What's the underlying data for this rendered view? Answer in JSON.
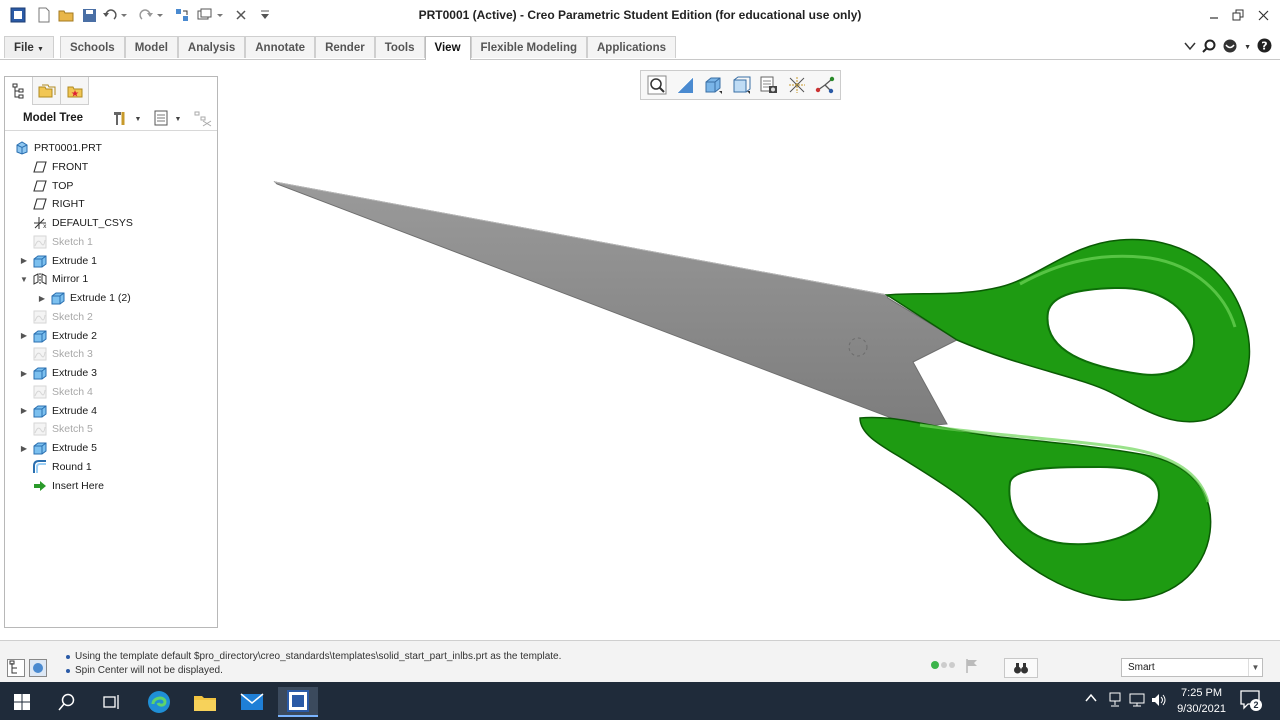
{
  "window": {
    "title": "PRT0001 (Active) - Creo Parametric Student Edition (for educational use only)"
  },
  "ribbon": {
    "file_label": "File",
    "tabs": [
      {
        "label": "Schools"
      },
      {
        "label": "Model"
      },
      {
        "label": "Analysis"
      },
      {
        "label": "Annotate"
      },
      {
        "label": "Render"
      },
      {
        "label": "Tools"
      },
      {
        "label": "View"
      },
      {
        "label": "Flexible Modeling"
      },
      {
        "label": "Applications"
      }
    ],
    "active_tab": "View"
  },
  "model_tree": {
    "title": "Model Tree",
    "items": [
      {
        "label": "PRT0001.PRT",
        "icon": "part-icon",
        "dim": false,
        "expand": ""
      },
      {
        "label": "FRONT",
        "icon": "datum-plane-icon",
        "dim": false,
        "expand": ""
      },
      {
        "label": "TOP",
        "icon": "datum-plane-icon",
        "dim": false,
        "expand": ""
      },
      {
        "label": "RIGHT",
        "icon": "datum-plane-icon",
        "dim": false,
        "expand": ""
      },
      {
        "label": "DEFAULT_CSYS",
        "icon": "csys-icon",
        "dim": false,
        "expand": ""
      },
      {
        "label": "Sketch 1",
        "icon": "sketch-icon",
        "dim": true,
        "expand": ""
      },
      {
        "label": "Extrude 1",
        "icon": "extrude-icon",
        "dim": false,
        "expand": "collapsed"
      },
      {
        "label": "Mirror 1",
        "icon": "mirror-icon",
        "dim": false,
        "expand": "expanded"
      },
      {
        "label": "Extrude 1 (2)",
        "icon": "extrude-icon",
        "dim": false,
        "expand": "collapsed"
      },
      {
        "label": "Sketch 2",
        "icon": "sketch-icon",
        "dim": true,
        "expand": ""
      },
      {
        "label": "Extrude 2",
        "icon": "extrude-icon",
        "dim": false,
        "expand": "collapsed"
      },
      {
        "label": "Sketch 3",
        "icon": "sketch-icon",
        "dim": true,
        "expand": ""
      },
      {
        "label": "Extrude 3",
        "icon": "extrude-icon",
        "dim": false,
        "expand": "collapsed"
      },
      {
        "label": "Sketch 4",
        "icon": "sketch-icon",
        "dim": true,
        "expand": ""
      },
      {
        "label": "Extrude 4",
        "icon": "extrude-icon",
        "dim": false,
        "expand": "collapsed"
      },
      {
        "label": "Sketch 5",
        "icon": "sketch-icon",
        "dim": true,
        "expand": ""
      },
      {
        "label": "Extrude 5",
        "icon": "extrude-icon",
        "dim": false,
        "expand": "collapsed"
      },
      {
        "label": "Round 1",
        "icon": "round-icon",
        "dim": false,
        "expand": ""
      },
      {
        "label": "Insert Here",
        "icon": "insert-arrow-icon",
        "dim": false,
        "expand": ""
      }
    ]
  },
  "status": {
    "messages": [
      "Using the template default $pro_directory\\creo_standards\\templates\\solid_start_part_inlbs.prt as the template.",
      "Spin Center will not be displayed."
    ],
    "filter_value": "Smart"
  },
  "taskbar": {
    "time": "7:25 PM",
    "date": "9/30/2021",
    "notifications": "2"
  },
  "colors": {
    "blade": "#8a8a8a",
    "handle": "#1e9b12",
    "taskbar": "#1f2b3a"
  }
}
